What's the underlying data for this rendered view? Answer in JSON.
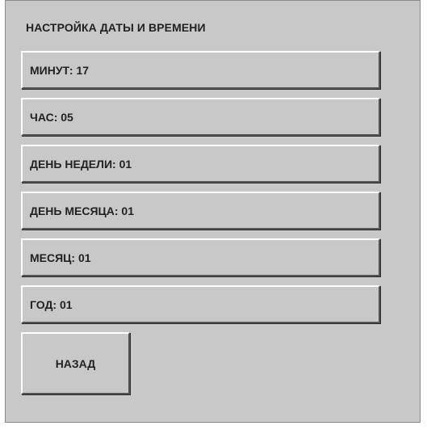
{
  "screen": {
    "title": "НАСТРОЙКА ДАТЫ И ВРЕМЕНИ"
  },
  "settings": [
    {
      "label": "МИНУТ: 17"
    },
    {
      "label": "ЧАС: 05"
    },
    {
      "label": "ДЕНЬ НЕДЕЛИ: 01"
    },
    {
      "label": "ДЕНЬ МЕСЯЦА: 01"
    },
    {
      "label": "МЕСЯЦ: 01"
    },
    {
      "label": "ГОД: 01"
    }
  ],
  "back_button": {
    "label": "НАЗАД"
  },
  "colors": {
    "panel_background": "#c8c8c8",
    "text": "#222222"
  }
}
